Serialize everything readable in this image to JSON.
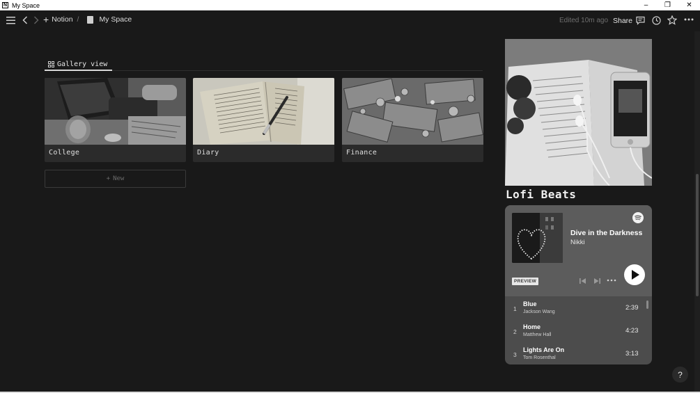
{
  "window": {
    "title": "My Space",
    "app_icon": "N"
  },
  "topbar": {
    "breadcrumb": [
      "Notion",
      "My Space"
    ],
    "breadcrumb_sep": "/",
    "edited": "Edited 10m ago",
    "share_label": "Share",
    "icons": [
      "menu-icon",
      "back-icon",
      "forward-icon",
      "add-icon",
      "page-icon",
      "comment-icon",
      "clock-icon",
      "star-icon",
      "more-icon"
    ]
  },
  "gallery": {
    "tab_label": "Gallery view",
    "cards": [
      {
        "label": "College"
      },
      {
        "label": "Diary"
      },
      {
        "label": "Finance"
      }
    ],
    "new_label": "New"
  },
  "lofi": {
    "title": "Lofi Beats"
  },
  "player": {
    "track_title": "Dive in the Darkness",
    "artist": "Nikki",
    "preview_label": "PREVIEW",
    "tracks": [
      {
        "num": "1",
        "name": "Blue",
        "by": "Jackson Wang",
        "dur": "2:39"
      },
      {
        "num": "2",
        "name": "Home",
        "by": "Matthew Hall",
        "dur": "4:23"
      },
      {
        "num": "3",
        "name": "Lights Are On",
        "by": "Tom Rosenthal",
        "dur": "3:13"
      }
    ]
  },
  "help": {
    "label": "?"
  },
  "colors": {
    "background": "#191919",
    "card": "#2b2b2b",
    "player": "#4c4c4c",
    "player_top": "#5c5c5c"
  }
}
